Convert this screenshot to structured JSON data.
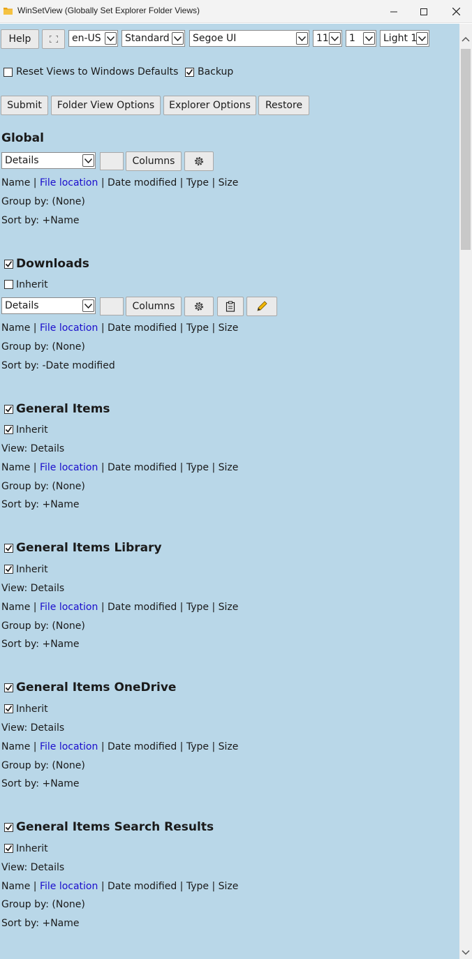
{
  "window": {
    "title": "WinSetView (Globally Set Explorer Folder Views)"
  },
  "toolbar": {
    "help_label": "Help",
    "language": "en-US",
    "mode": "Standard",
    "font": "Segoe UI",
    "font_size": "11",
    "spacing": "1",
    "theme": "Light 1"
  },
  "options": {
    "reset_label": "Reset Views to Windows Defaults",
    "backup_label": "Backup"
  },
  "actions": {
    "submit": "Submit",
    "folder_view_options": "Folder View Options",
    "explorer_options": "Explorer Options",
    "restore": "Restore"
  },
  "columns_label": "Columns",
  "inherit_label": "Inherit",
  "sep": " | ",
  "global": {
    "heading": "Global",
    "view": "Details",
    "col_name": "Name",
    "col_file_location": "File location",
    "col_date_modified": "Date modified",
    "col_type": "Type",
    "col_size": "Size",
    "group_by": "Group by: (None)",
    "sort_by": "Sort by: +Name"
  },
  "downloads": {
    "heading": "Downloads",
    "view": "Details",
    "col_name": "Name",
    "col_file_location": "File location",
    "col_date_modified": "Date modified",
    "col_type": "Type",
    "col_size": "Size",
    "group_by": "Group by: (None)",
    "sort_by": "Sort by: -Date modified"
  },
  "sections": [
    {
      "heading": "General Items",
      "view": "View: Details",
      "col_name": "Name",
      "col_file_location": "File location",
      "col_date_modified": "Date modified",
      "col_type": "Type",
      "col_size": "Size",
      "group_by": "Group by: (None)",
      "sort_by": "Sort by: +Name"
    },
    {
      "heading": "General Items Library",
      "view": "View: Details",
      "col_name": "Name",
      "col_file_location": "File location",
      "col_date_modified": "Date modified",
      "col_type": "Type",
      "col_size": "Size",
      "group_by": "Group by: (None)",
      "sort_by": "Sort by: +Name"
    },
    {
      "heading": "General Items OneDrive",
      "view": "View: Details",
      "col_name": "Name",
      "col_file_location": "File location",
      "col_date_modified": "Date modified",
      "col_type": "Type",
      "col_size": "Size",
      "group_by": "Group by: (None)",
      "sort_by": "Sort by: +Name"
    },
    {
      "heading": "General Items Search Results",
      "view": "View: Details",
      "col_name": "Name",
      "col_file_location": "File location",
      "col_date_modified": "Date modified",
      "col_type": "Type",
      "col_size": "Size",
      "group_by": "Group by: (None)",
      "sort_by": "Sort by: +Name"
    }
  ],
  "colors": {
    "background": "#b9d7e8",
    "link": "#1a0dcc",
    "button": "#eaeaea"
  },
  "icons": {
    "app": "folder-icon",
    "settings": "gear-icon",
    "paste": "clipboard-icon",
    "edit": "pencil-icon",
    "fullscreen": "fullscreen-icon"
  }
}
